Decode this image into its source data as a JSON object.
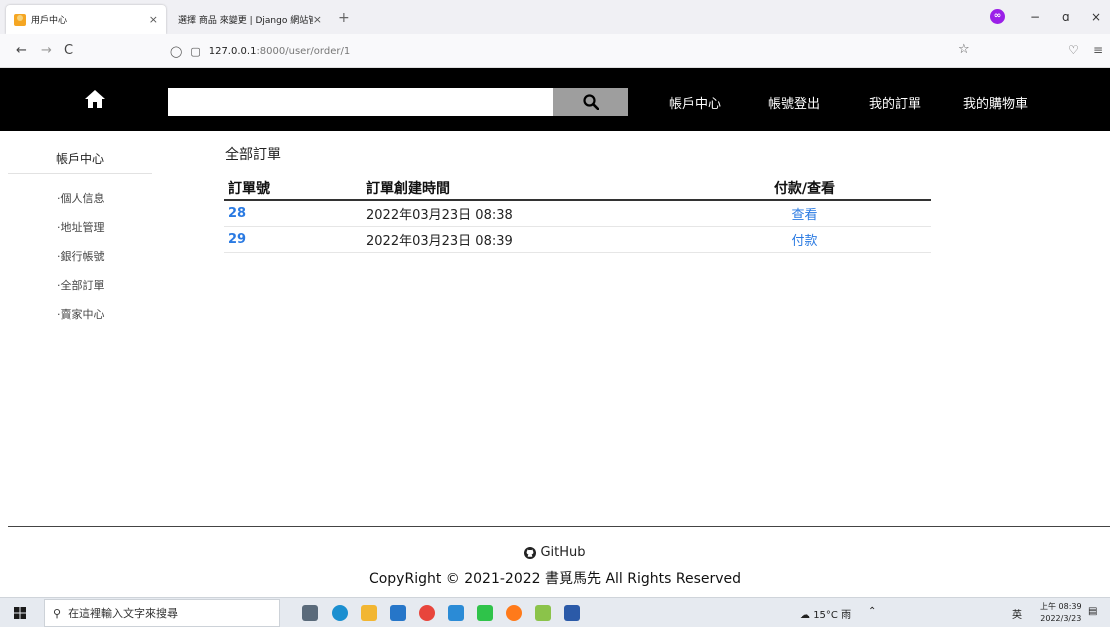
{
  "browser": {
    "tabs": [
      {
        "title": "用戶中心",
        "close": "×"
      },
      {
        "title": "選擇 商品 來變更 | Django 網站管理",
        "close": "×"
      }
    ],
    "new_tab": "+",
    "window_controls": {
      "minimize": "−",
      "restore": "ɑ",
      "close": "×"
    },
    "url_host": "127.0.0.1",
    "url_path": ":8000/user/order/1",
    "nav": {
      "back": "←",
      "forward": "→",
      "reload": "C"
    }
  },
  "header": {
    "search_placeholder": "",
    "links": [
      "帳戶中心",
      "帳號登出",
      "我的訂單",
      "我的購物車"
    ]
  },
  "sidebar": {
    "title": "帳戶中心",
    "items": [
      "·個人信息",
      "·地址管理",
      "·銀行帳號",
      "·全部訂單",
      "·賣家中心"
    ]
  },
  "main": {
    "title": "全部訂單",
    "columns": [
      "訂單號",
      "訂單創建時間",
      "付款/查看"
    ],
    "orders": [
      {
        "id": "28",
        "created": "2022年03月23日 08:38",
        "action": "查看"
      },
      {
        "id": "29",
        "created": "2022年03月23日 08:39",
        "action": "付款"
      }
    ]
  },
  "footer": {
    "github": "GitHub",
    "copyright": "CopyRight © 2021-2022 書覓馬先 All Rights Reserved"
  },
  "taskbar": {
    "search_placeholder": "在這裡輸入文字來搜尋",
    "weather": "15°C 雨",
    "ime": "英",
    "time": "上午 08:39",
    "date": "2022/3/23"
  },
  "colors": {
    "header_bg": "#000000",
    "link": "#2a7ae2",
    "search_button": "#9e9e9e"
  }
}
